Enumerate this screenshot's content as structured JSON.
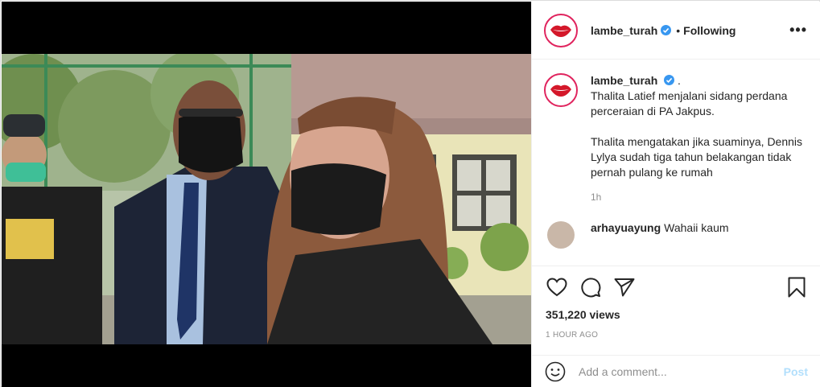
{
  "post": {
    "username": "lambe_turah",
    "separator": "•",
    "follow_status": "Following",
    "more_label": "•••"
  },
  "caption": {
    "username": "lambe_turah",
    "suffix": ".",
    "text": "Thalita Latief menjalani sidang perdana perceraian di PA Jakpus.\n\nThalita mengatakan jika suaminya, Dennis Lylya sudah tiga tahun belakangan tidak pernah pulang ke rumah",
    "time": "1h"
  },
  "comment": {
    "username": "arhayuayung",
    "text": "Wahaii kaum"
  },
  "stats": {
    "views": "351,220 views",
    "posted": "1 HOUR AGO"
  },
  "add_comment": {
    "placeholder": "Add a comment...",
    "post_label": "Post"
  },
  "icons": {
    "like": "heart-icon",
    "comment": "comment-bubble-icon",
    "share": "paper-plane-icon",
    "save": "bookmark-icon",
    "mute": "speaker-icon",
    "emoji": "emoji-icon",
    "verified": "verified-badge-icon"
  },
  "colors": {
    "verified": "#3897f0",
    "avatar_ring": "#e0245e",
    "post_disabled": "#b2dffc"
  }
}
